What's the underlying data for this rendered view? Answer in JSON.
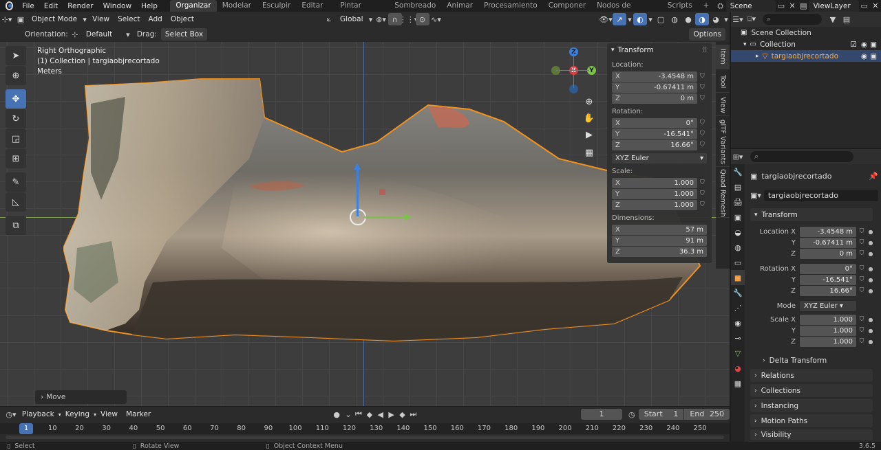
{
  "menubar": {
    "menus": [
      "File",
      "Edit",
      "Render",
      "Window",
      "Help"
    ],
    "workspaces": [
      "Organizar",
      "Modelar",
      "Esculpir",
      "Editar UV",
      "Pintar texturas",
      "Sombreado",
      "Animar",
      "Procesamiento",
      "Componer",
      "Nodos de geometría",
      "Scripts"
    ],
    "active_workspace": "Organizar",
    "scene": "Scene",
    "view_layer": "ViewLayer"
  },
  "viewport_header": {
    "mode": "Object Mode",
    "menus": [
      "View",
      "Select",
      "Add",
      "Object"
    ],
    "transform_orientation": "Global"
  },
  "tool_header": {
    "orientation_label": "Orientation:",
    "orientation_value": "Default",
    "drag_label": "Drag:",
    "drag_value": "Select Box",
    "options": "Options"
  },
  "viewport": {
    "view_name": "Right Orthographic",
    "collection_info": "(1) Collection | targiaobjrecortado",
    "units": "Meters",
    "last_operator": "Move",
    "gizmo_axes": [
      "Z",
      "X",
      "Y"
    ]
  },
  "side_tabs": [
    "Item",
    "Tool",
    "View",
    "glTF Variants",
    "Quad Remesh"
  ],
  "transform_panel": {
    "title": "Transform",
    "location_label": "Location:",
    "location": [
      {
        "axis": "X",
        "value": "-3.4548 m"
      },
      {
        "axis": "Y",
        "value": "-0.67411 m"
      },
      {
        "axis": "Z",
        "value": "0 m"
      }
    ],
    "rotation_label": "Rotation:",
    "rotation": [
      {
        "axis": "X",
        "value": "0°"
      },
      {
        "axis": "Y",
        "value": "-16.541°"
      },
      {
        "axis": "Z",
        "value": "16.66°"
      }
    ],
    "rotation_mode": "XYZ Euler",
    "scale_label": "Scale:",
    "scale": [
      {
        "axis": "X",
        "value": "1.000"
      },
      {
        "axis": "Y",
        "value": "1.000"
      },
      {
        "axis": "Z",
        "value": "1.000"
      }
    ],
    "dimensions_label": "Dimensions:",
    "dimensions": [
      {
        "axis": "X",
        "value": "57 m"
      },
      {
        "axis": "Y",
        "value": "91 m"
      },
      {
        "axis": "Z",
        "value": "36.3 m"
      }
    ]
  },
  "outliner": {
    "items": [
      {
        "name": "Scene Collection"
      },
      {
        "name": "Collection"
      },
      {
        "name": "targiaobjrecortado"
      }
    ]
  },
  "properties": {
    "object_name": "targiaobjrecortado",
    "data_name": "targiaobjrecortado",
    "transform_title": "Transform",
    "location_labels": [
      "Location X",
      "Y",
      "Z"
    ],
    "location_values": [
      "-3.4548 m",
      "-0.67411 m",
      "0 m"
    ],
    "rotation_labels": [
      "Rotation X",
      "Y",
      "Z"
    ],
    "rotation_values": [
      "0°",
      "-16.541°",
      "16.66°"
    ],
    "mode_label": "Mode",
    "mode_value": "XYZ Euler",
    "scale_labels": [
      "Scale X",
      "Y",
      "Z"
    ],
    "scale_values": [
      "1.000",
      "1.000",
      "1.000"
    ],
    "delta_transform": "Delta Transform",
    "sections": [
      "Relations",
      "Collections",
      "Instancing",
      "Motion Paths",
      "Visibility"
    ]
  },
  "timeline": {
    "menus": [
      "Playback",
      "Keying",
      "View",
      "Marker"
    ],
    "current_frame": "1",
    "start_label": "Start",
    "start": "1",
    "end_label": "End",
    "end": "250",
    "ruler": [
      "1",
      "10",
      "20",
      "30",
      "40",
      "50",
      "60",
      "70",
      "80",
      "90",
      "100",
      "110",
      "120",
      "130",
      "140",
      "150",
      "160",
      "170",
      "180",
      "190",
      "200",
      "210",
      "220",
      "230",
      "240",
      "250"
    ]
  },
  "statusbar": {
    "select": "Select",
    "rotate": "Rotate View",
    "context": "Object Context Menu",
    "version": "3.6.5"
  }
}
